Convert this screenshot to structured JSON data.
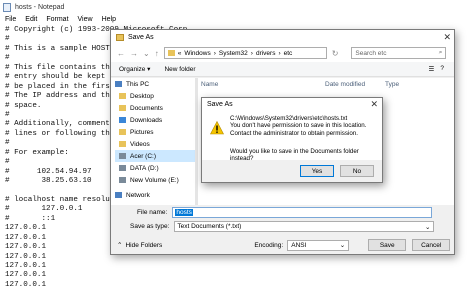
{
  "notepad": {
    "title": "hosts - Notepad",
    "menu": [
      "File",
      "Edit",
      "Format",
      "View",
      "Help"
    ],
    "lines": [
      "# Copyright (c) 1993-2009 Microsoft Corp.",
      "#",
      "# This is a sample HOSTS fi",
      "#",
      "# This file contains the map",
      "# entry should be kept on a",
      "# be placed in the first col",
      "# The IP address and the hos",
      "# space.",
      "#",
      "# Additionally, comments (su",
      "# lines or following the mac",
      "#",
      "# For example:",
      "#",
      "#      102.54.94.97     rhi",
      "#       38.25.63.10     x.a",
      "",
      "# localhost name resolution",
      "#       127.0.0.1       loc",
      "#       ::1             loc",
      "127.0.0.1",
      "127.0.0.1",
      "127.0.0.1",
      "127.0.0.1",
      "127.0.0.1",
      "127.0.0.1",
      "127.0.0.1"
    ]
  },
  "save_as": {
    "title": "Save As",
    "breadcrumb": [
      "Windows",
      "System32",
      "drivers",
      "etc"
    ],
    "search_placeholder": "Search etc",
    "toolbar": {
      "organize": "Organize",
      "new_folder": "New folder"
    },
    "columns": [
      "Name",
      "Date modified",
      "Type"
    ],
    "nav_items": [
      {
        "label": "This PC",
        "icon": "computer-icon"
      },
      {
        "label": "Desktop",
        "icon": "folder-icon"
      },
      {
        "label": "Documents",
        "icon": "folder-icon"
      },
      {
        "label": "Downloads",
        "icon": "download-icon"
      },
      {
        "label": "Pictures",
        "icon": "folder-icon"
      },
      {
        "label": "Videos",
        "icon": "folder-icon"
      },
      {
        "label": "Acer (C:)",
        "icon": "drive-icon",
        "selected": true
      },
      {
        "label": "DATA (D:)",
        "icon": "drive-icon"
      },
      {
        "label": "New Volume (E:)",
        "icon": "drive-icon"
      },
      {
        "label": "Network",
        "icon": "network-icon"
      }
    ],
    "file_name_label": "File name:",
    "file_name_value": "hosts",
    "save_type_label": "Save as type:",
    "save_type_value": "Text Documents (*.txt)",
    "hide_folders": "Hide Folders",
    "encoding_label": "Encoding:",
    "encoding_value": "ANSI",
    "save_button": "Save",
    "cancel_button": "Cancel"
  },
  "alert": {
    "title": "Save As",
    "message_lines": [
      "C:\\Windows\\System32\\drivers\\etc\\hosts.txt",
      "You don't have permission to save in this location.",
      "Contact the administrator to obtain permission."
    ],
    "question": "Would you like to save in the Documents folder instead?",
    "yes_button": "Yes",
    "no_button": "No"
  },
  "colors": {
    "accent": "#0078d7",
    "folder": "#e8c35a",
    "selection": "#cce8ff"
  }
}
